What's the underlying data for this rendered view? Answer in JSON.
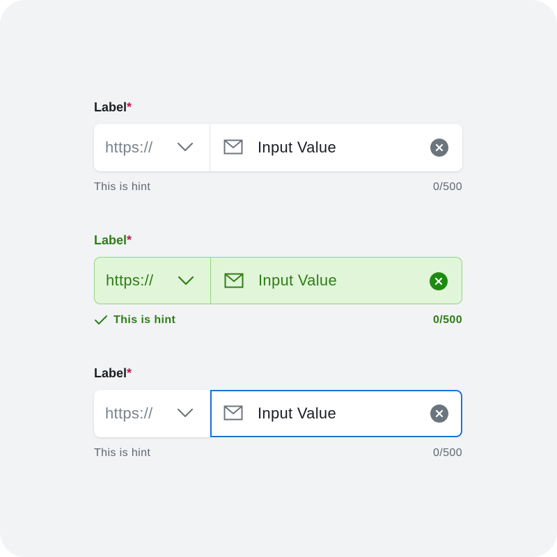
{
  "fields": [
    {
      "variant": "default",
      "label": "Label",
      "required_mark": "*",
      "prefix": "https://",
      "value": "Input Value",
      "hint": "This is hint",
      "counter": "0/500",
      "icons": [
        "chevron-down-icon",
        "mail-icon",
        "clear-icon"
      ]
    },
    {
      "variant": "success",
      "label": "Label",
      "required_mark": "*",
      "prefix": "https://",
      "value": "Input Value",
      "hint": "This is hint",
      "counter": "0/500",
      "icons": [
        "chevron-down-icon",
        "mail-icon",
        "clear-icon",
        "check-icon"
      ]
    },
    {
      "variant": "focused",
      "label": "Label",
      "required_mark": "*",
      "prefix": "https://",
      "value": "Input Value",
      "hint": "This is hint",
      "counter": "0/500",
      "icons": [
        "chevron-down-icon",
        "mail-icon",
        "clear-icon"
      ]
    }
  ],
  "colors": {
    "background": "#f1f3f5",
    "required": "#c2184b",
    "success": "#2e7d16",
    "success_fill": "#e1f5d9",
    "focus_border": "#1a73d9",
    "muted": "#7a838c"
  }
}
